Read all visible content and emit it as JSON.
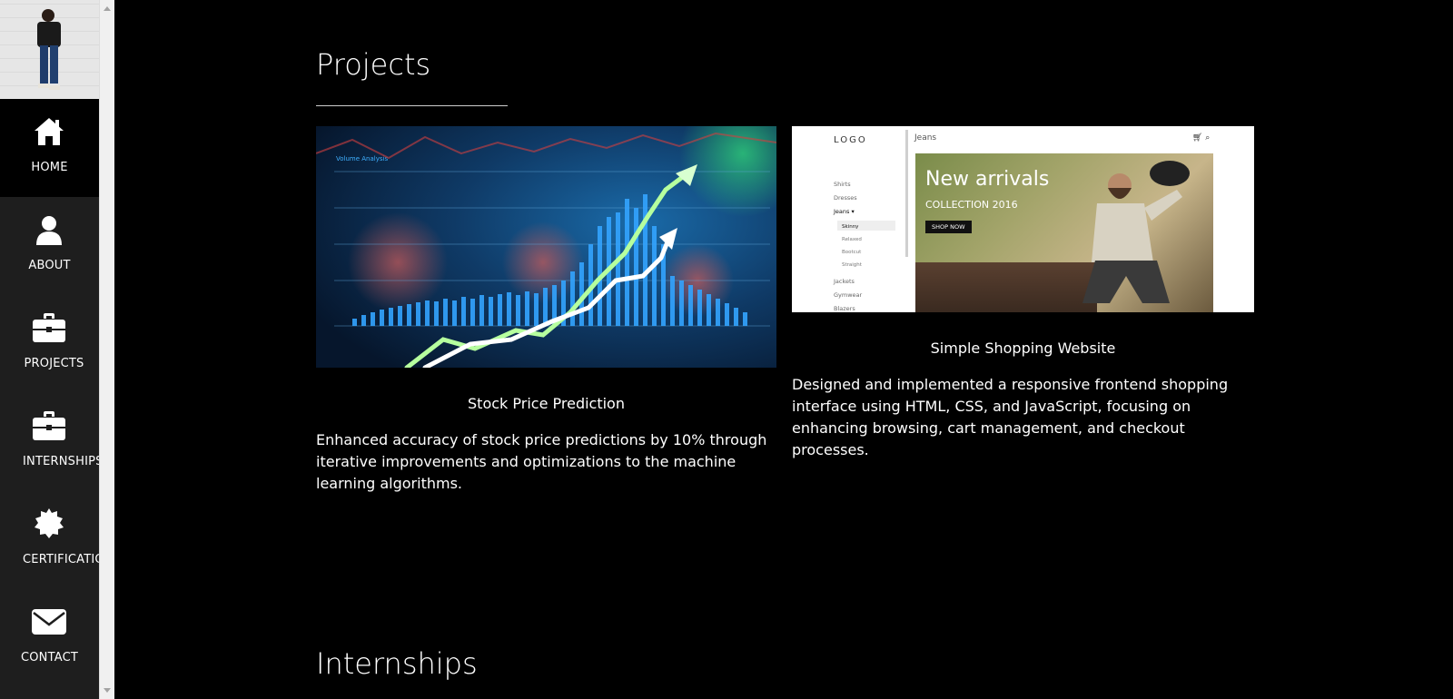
{
  "sidebar": {
    "items": [
      {
        "label": "HOME",
        "icon": "home-icon",
        "active": true
      },
      {
        "label": "ABOUT",
        "icon": "user-icon",
        "active": false
      },
      {
        "label": "PROJECTS",
        "icon": "briefcase-icon",
        "active": false
      },
      {
        "label": "INTERNSHIPS",
        "icon": "briefcase-icon",
        "active": false
      },
      {
        "label": "CERTIFICATIO",
        "icon": "certificate-icon",
        "active": false
      },
      {
        "label": "CONTACT",
        "icon": "envelope-icon",
        "active": false
      }
    ]
  },
  "projects": {
    "title": "Projects",
    "cards": [
      {
        "title": "Stock Price Prediction",
        "description": "Enhanced accuracy of stock price predictions by 10% through iterative improvements and optimizations to the machine learning algorithms.",
        "image_caption": "Volume Analysis"
      },
      {
        "title": "Simple Shopping Website",
        "description": "Designed and implemented a responsive frontend shopping interface using HTML, CSS, and JavaScript, focusing on enhancing browsing, cart management, and checkout processes.",
        "mock": {
          "logo": "LOGO",
          "header": "Jeans",
          "menu": [
            "Shirts",
            "Dresses",
            "Jeans ▾"
          ],
          "submenu": [
            "Skinny",
            "Relaxed",
            "Bootcut",
            "Straight"
          ],
          "menu2": [
            "Jackets",
            "Gymwear",
            "Blazers"
          ],
          "hero_title": "New arrivals",
          "hero_sub": "COLLECTION 2016",
          "hero_button": "SHOP NOW"
        }
      }
    ]
  },
  "internships": {
    "title": "Internships"
  },
  "colors": {
    "background": "#000000",
    "sidebar": "#1e1e1e",
    "text": "#ffffff"
  }
}
